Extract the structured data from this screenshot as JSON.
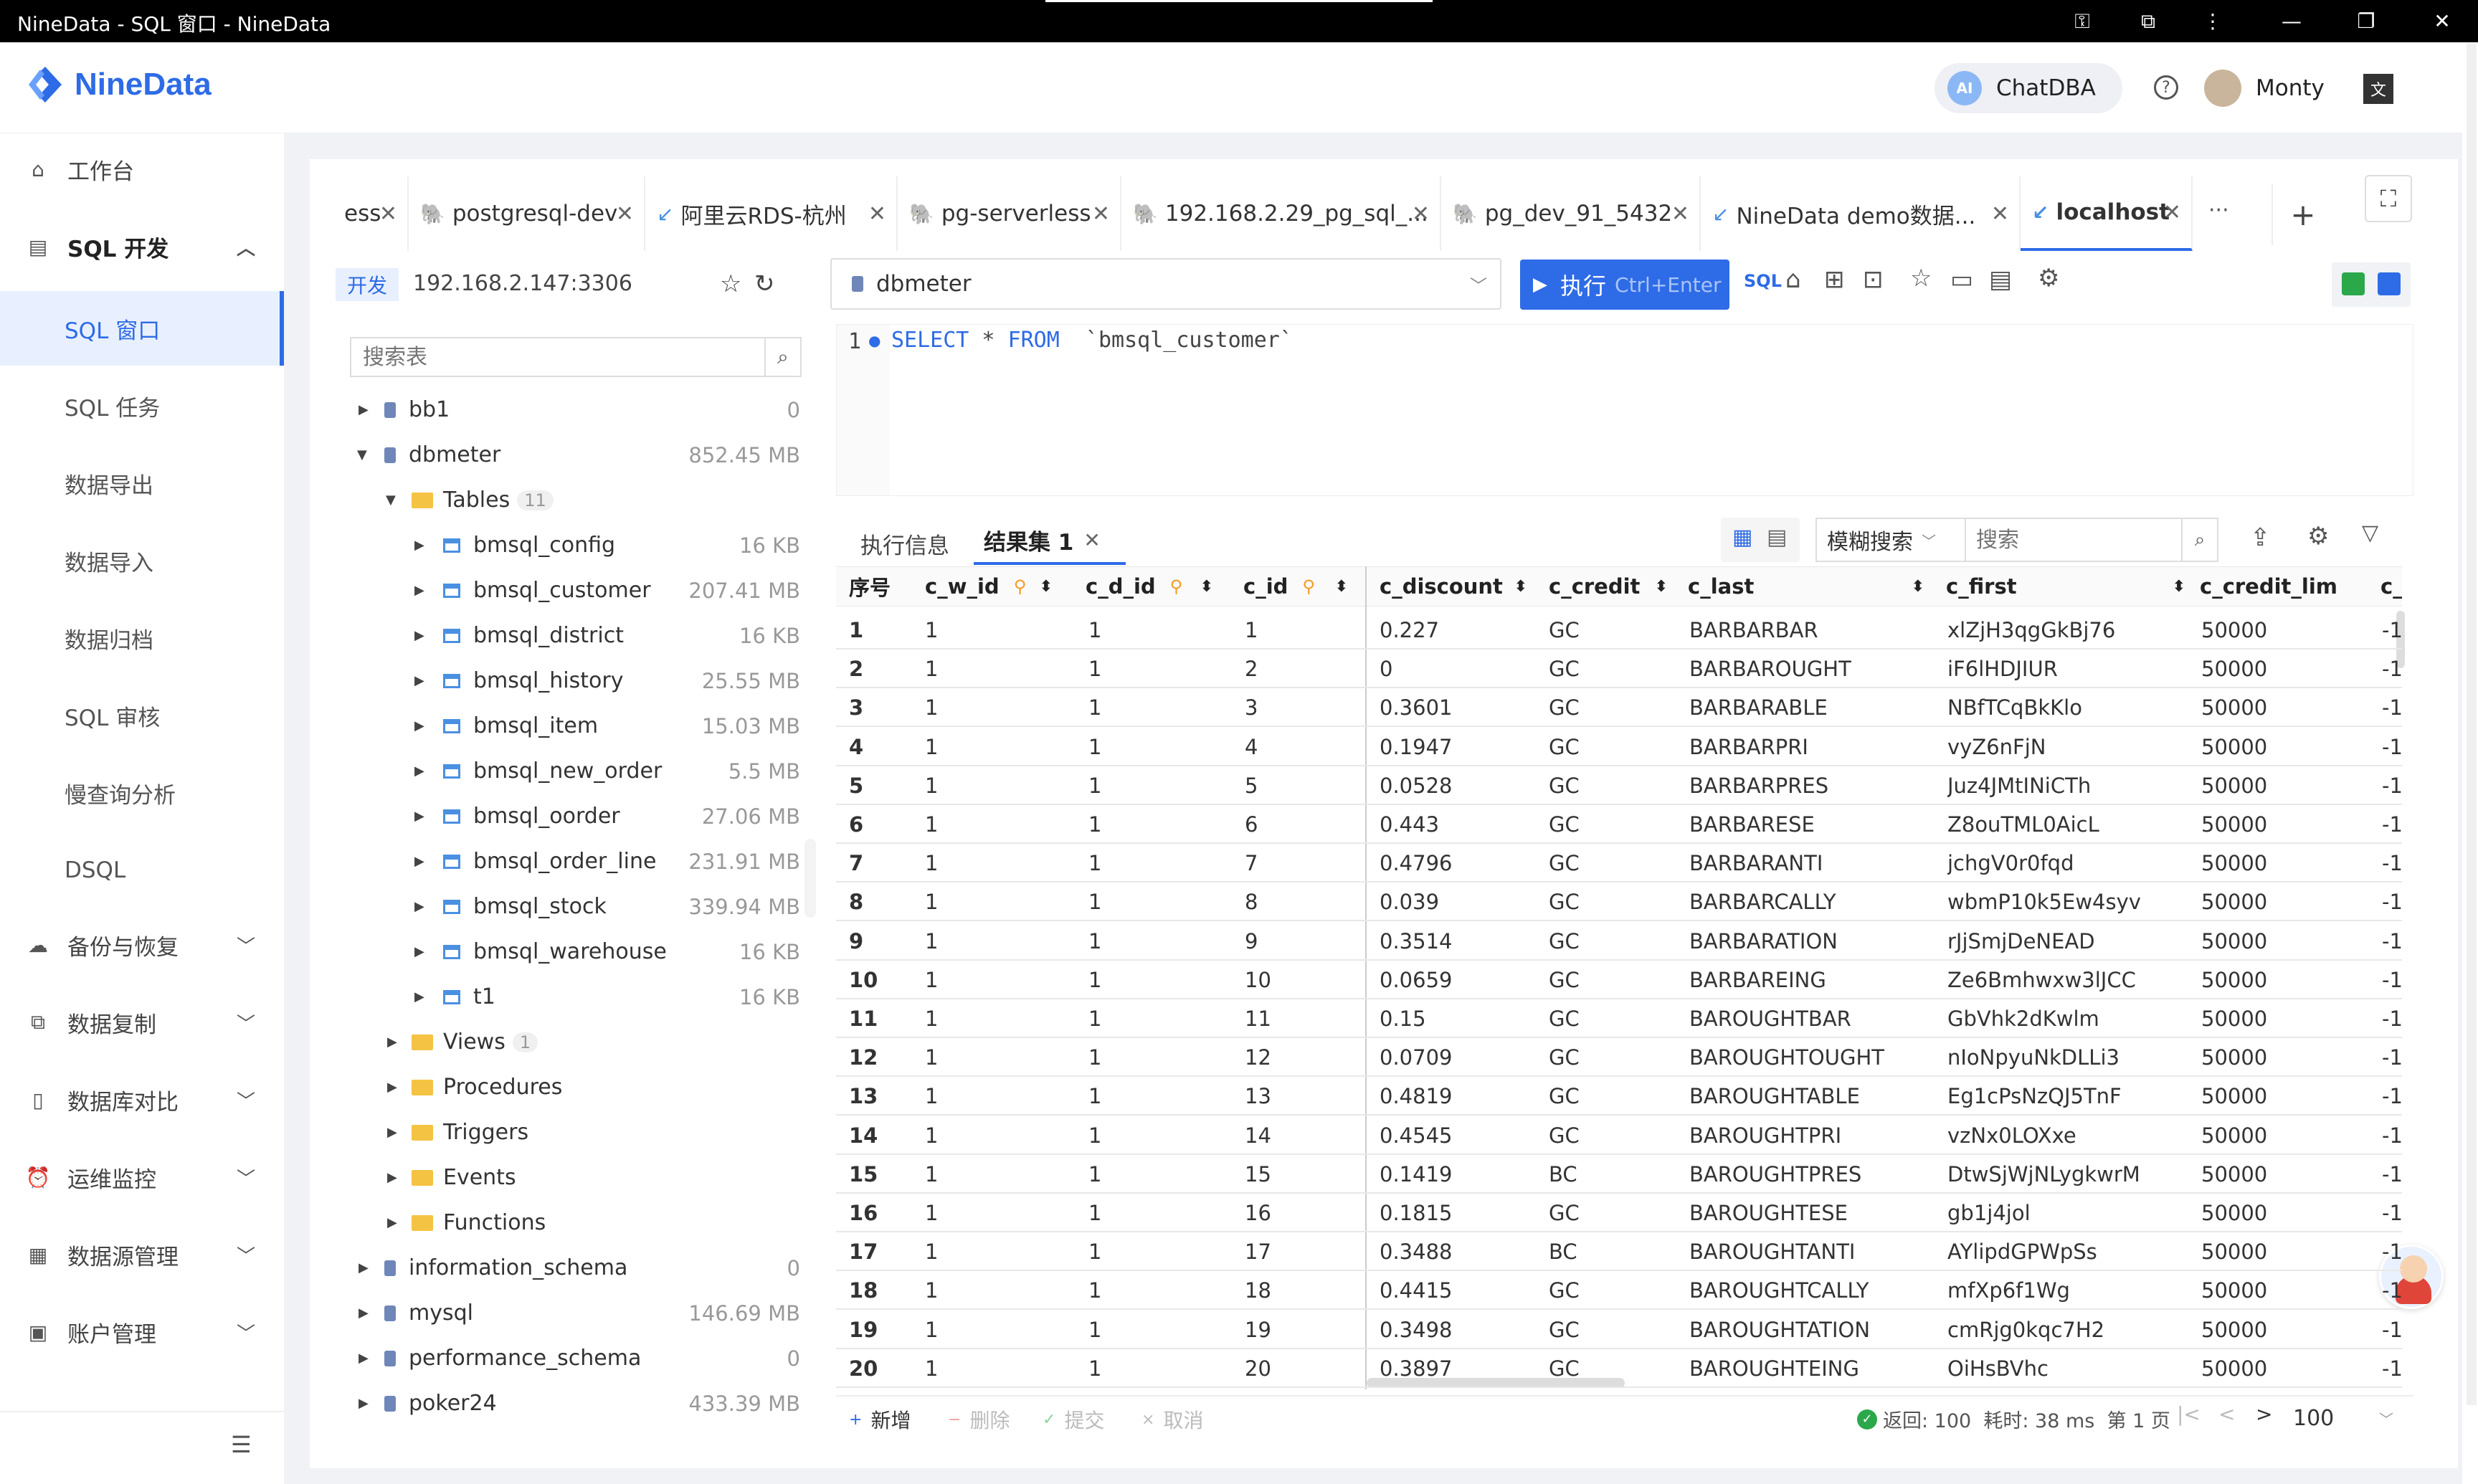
{
  "window": {
    "title": "NineData - SQL 窗口 - NineData"
  },
  "header": {
    "logo_text": "NineData",
    "chatdba": "ChatDBA",
    "ai_badge": "AI",
    "user": "Monty"
  },
  "sidebar": {
    "items": [
      {
        "label": "工作台",
        "icon": "home-icon"
      },
      {
        "label": "SQL 开发",
        "icon": "sql-dev-icon"
      },
      {
        "label": "备份与恢复",
        "icon": "backup-icon"
      },
      {
        "label": "数据复制",
        "icon": "replication-icon"
      },
      {
        "label": "数据库对比",
        "icon": "compare-icon"
      },
      {
        "label": "运维监控",
        "icon": "monitor-icon"
      },
      {
        "label": "数据源管理",
        "icon": "datasource-icon"
      },
      {
        "label": "账户管理",
        "icon": "account-icon"
      }
    ],
    "sub": [
      "SQL 窗口",
      "SQL 任务",
      "数据导出",
      "数据导入",
      "数据归档",
      "SQL 审核",
      "慢查询分析",
      "DSQL"
    ]
  },
  "tabs": [
    "ess",
    "postgresql-dev",
    "阿里云RDS-杭州",
    "pg-serverless",
    "192.168.2.29_pg_sql_...",
    "pg_dev_91_5432",
    "NineData demo数据...",
    "localhost"
  ],
  "more_tabs": "···",
  "connection": {
    "env": "开发",
    "host": "192.168.2.147:3306",
    "db": "dbmeter"
  },
  "search": {
    "placeholder": "搜索表"
  },
  "tree": [
    {
      "label": "bb1",
      "size": "0"
    },
    {
      "label": "dbmeter",
      "size": "852.45 MB"
    },
    {
      "label": "Tables",
      "count": "11"
    },
    {
      "label": "bmsql_config",
      "size": "16 KB"
    },
    {
      "label": "bmsql_customer",
      "size": "207.41 MB"
    },
    {
      "label": "bmsql_district",
      "size": "16 KB"
    },
    {
      "label": "bmsql_history",
      "size": "25.55 MB"
    },
    {
      "label": "bmsql_item",
      "size": "15.03 MB"
    },
    {
      "label": "bmsql_new_order",
      "size": "5.5 MB"
    },
    {
      "label": "bmsql_oorder",
      "size": "27.06 MB"
    },
    {
      "label": "bmsql_order_line",
      "size": "231.91 MB"
    },
    {
      "label": "bmsql_stock",
      "size": "339.94 MB"
    },
    {
      "label": "bmsql_warehouse",
      "size": "16 KB"
    },
    {
      "label": "t1",
      "size": "16 KB"
    },
    {
      "label": "Views",
      "count": "1"
    },
    {
      "label": "Procedures"
    },
    {
      "label": "Triggers"
    },
    {
      "label": "Events"
    },
    {
      "label": "Functions"
    },
    {
      "label": "information_schema",
      "size": "0"
    },
    {
      "label": "mysql",
      "size": "146.69 MB"
    },
    {
      "label": "performance_schema",
      "size": "0"
    },
    {
      "label": "poker24",
      "size": "433.39 MB"
    }
  ],
  "toolbar": {
    "execute": "执行",
    "shortcut": "Ctrl+Enter"
  },
  "editor": {
    "line": "1",
    "sql_kw1": "SELECT",
    "sql_mid": " * ",
    "sql_kw2": "FROM",
    "sql_tbl": "`bmsql_customer`"
  },
  "result_tabs": {
    "info": "执行信息",
    "result": "结果集 1"
  },
  "result_search": {
    "mode": "模糊搜索",
    "placeholder": "搜索"
  },
  "columns": [
    "序号",
    "c_w_id",
    "c_d_id",
    "c_id",
    "c_discount",
    "c_credit",
    "c_last",
    "c_first",
    "c_credit_lim",
    "c_b"
  ],
  "rows": [
    [
      "1",
      "1",
      "1",
      "1",
      "0.227",
      "GC",
      "BARBARBAR",
      "xlZjH3qgGkBj76",
      "50000",
      "-1"
    ],
    [
      "2",
      "1",
      "1",
      "2",
      "0",
      "GC",
      "BARBAROUGHT",
      "iF6lHDJIUR",
      "50000",
      "-1"
    ],
    [
      "3",
      "1",
      "1",
      "3",
      "0.3601",
      "GC",
      "BARBARABLE",
      "NBfTCqBkKlo",
      "50000",
      "-1"
    ],
    [
      "4",
      "1",
      "1",
      "4",
      "0.1947",
      "GC",
      "BARBARPRI",
      "vyZ6nFjN",
      "50000",
      "-1"
    ],
    [
      "5",
      "1",
      "1",
      "5",
      "0.0528",
      "GC",
      "BARBARPRES",
      "Juz4JMtINiCTh",
      "50000",
      "-1"
    ],
    [
      "6",
      "1",
      "1",
      "6",
      "0.443",
      "GC",
      "BARBARESE",
      "Z8ouTML0AicL",
      "50000",
      "-1"
    ],
    [
      "7",
      "1",
      "1",
      "7",
      "0.4796",
      "GC",
      "BARBARANTI",
      "jchgV0r0fqd",
      "50000",
      "-1"
    ],
    [
      "8",
      "1",
      "1",
      "8",
      "0.039",
      "GC",
      "BARBARCALLY",
      "wbmP10k5Ew4syv",
      "50000",
      "-1"
    ],
    [
      "9",
      "1",
      "1",
      "9",
      "0.3514",
      "GC",
      "BARBARATION",
      "rJjSmjDeNEAD",
      "50000",
      "-1"
    ],
    [
      "10",
      "1",
      "1",
      "10",
      "0.0659",
      "GC",
      "BARBAREING",
      "Ze6Bmhwxw3lJCC",
      "50000",
      "-1"
    ],
    [
      "11",
      "1",
      "1",
      "11",
      "0.15",
      "GC",
      "BAROUGHTBAR",
      "GbVhk2dKwlm",
      "50000",
      "-1"
    ],
    [
      "12",
      "1",
      "1",
      "12",
      "0.0709",
      "GC",
      "BAROUGHTOUGHT",
      "nIoNpyuNkDLLi3",
      "50000",
      "-1"
    ],
    [
      "13",
      "1",
      "1",
      "13",
      "0.4819",
      "GC",
      "BAROUGHTABLE",
      "Eg1cPsNzQJ5TnF",
      "50000",
      "-1"
    ],
    [
      "14",
      "1",
      "1",
      "14",
      "0.4545",
      "GC",
      "BAROUGHTPRI",
      "vzNx0LOXxe",
      "50000",
      "-1"
    ],
    [
      "15",
      "1",
      "1",
      "15",
      "0.1419",
      "BC",
      "BAROUGHTPRES",
      "DtwSjWjNLygkwrM",
      "50000",
      "-1"
    ],
    [
      "16",
      "1",
      "1",
      "16",
      "0.1815",
      "GC",
      "BAROUGHTESE",
      "gb1j4jol",
      "50000",
      "-1"
    ],
    [
      "17",
      "1",
      "1",
      "17",
      "0.3488",
      "BC",
      "BAROUGHTANTI",
      "AYlipdGPWpSs",
      "50000",
      "-1"
    ],
    [
      "18",
      "1",
      "1",
      "18",
      "0.4415",
      "GC",
      "BAROUGHTCALLY",
      "mfXp6f1Wg",
      "50000",
      "-1"
    ],
    [
      "19",
      "1",
      "1",
      "19",
      "0.3498",
      "GC",
      "BAROUGHTATION",
      "cmRjg0kqc7H2",
      "50000",
      "-1"
    ],
    [
      "20",
      "1",
      "1",
      "20",
      "0.3897",
      "GC",
      "BAROUGHTEING",
      "OiHsBVhc",
      "50000",
      "-1"
    ]
  ],
  "footer": {
    "add": "新增",
    "delete": "删除",
    "commit": "提交",
    "cancel": "取消",
    "status": "返回: 100  耗时: 38 ms  第 1 页",
    "page_size": "100"
  },
  "colors": {
    "accent": "#2e6be6",
    "bg": "#f0f2f5"
  }
}
